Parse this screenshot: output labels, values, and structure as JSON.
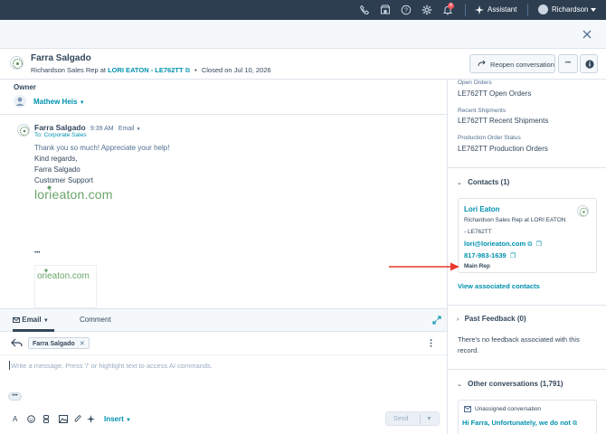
{
  "topnav": {
    "assistant_label": "Assistant",
    "user_label": "Richardson",
    "notification_count": "8"
  },
  "header": {
    "name": "Farra Salgado",
    "subtitle_prefix": "Richardson Sales Rep at",
    "company_link": "LORI EATON - LE762TT",
    "closed_text": "Closed on Jul 10, 2026",
    "reopen_label": "Reopen conversation",
    "more_label": "•••"
  },
  "owner": {
    "label": "Owner",
    "name": "Mathew Heis"
  },
  "message": {
    "sender": "Farra Salgado",
    "time": "9:39 AM",
    "channel": "Email",
    "to_line": "To: Corporate Sales",
    "lines": [
      "Thank you so much! Appreciate your help!",
      "Kind regards,",
      "Farra Salgado",
      "Customer Support"
    ],
    "logo_text": "lorieaton.com",
    "ellipsis": "•••",
    "logo_text_small": "orieaton.com"
  },
  "editor": {
    "tab_email": "Email",
    "tab_comment": "Comment",
    "recipient": "Farra Salgado",
    "placeholder": "Write a message. Press '/' or highlight text to access AI commands.",
    "insert_label": "Insert",
    "send_label": "Send"
  },
  "sidebar": {
    "open_orders_label": "Open Orders",
    "open_orders_value": "LE762TT Open Orders",
    "recent_shipments_label": "Recent Shipments",
    "recent_shipments_value": "LE762TT Recent Shipments",
    "production_status_label": "Production Order Status",
    "production_status_value": "LE762TT Production Orders",
    "contacts_title": "Contacts (1)",
    "contact": {
      "name": "Lori Eaton",
      "title_line1": "Richardson Sales Rep at LORI EATON",
      "title_line2": "- LE762TT",
      "email": "lori@lorieaton.com",
      "phone": "817-983-1639",
      "tag": "Main Rep"
    },
    "view_contacts_link": "View associated contacts",
    "past_feedback_title": "Past Feedback (0)",
    "past_feedback_empty": "There's no feedback associated with this record.",
    "other_conversations_title": "Other conversations (1,791)",
    "conversation": {
      "status": "Unassigned conversation",
      "preview": "Hi Farra, Unfortunately, we do not"
    }
  },
  "colors": {
    "nav_bg": "#2d3e50",
    "link": "#0091ae",
    "arrow": "#e8382c",
    "notification": "#f2545b"
  }
}
